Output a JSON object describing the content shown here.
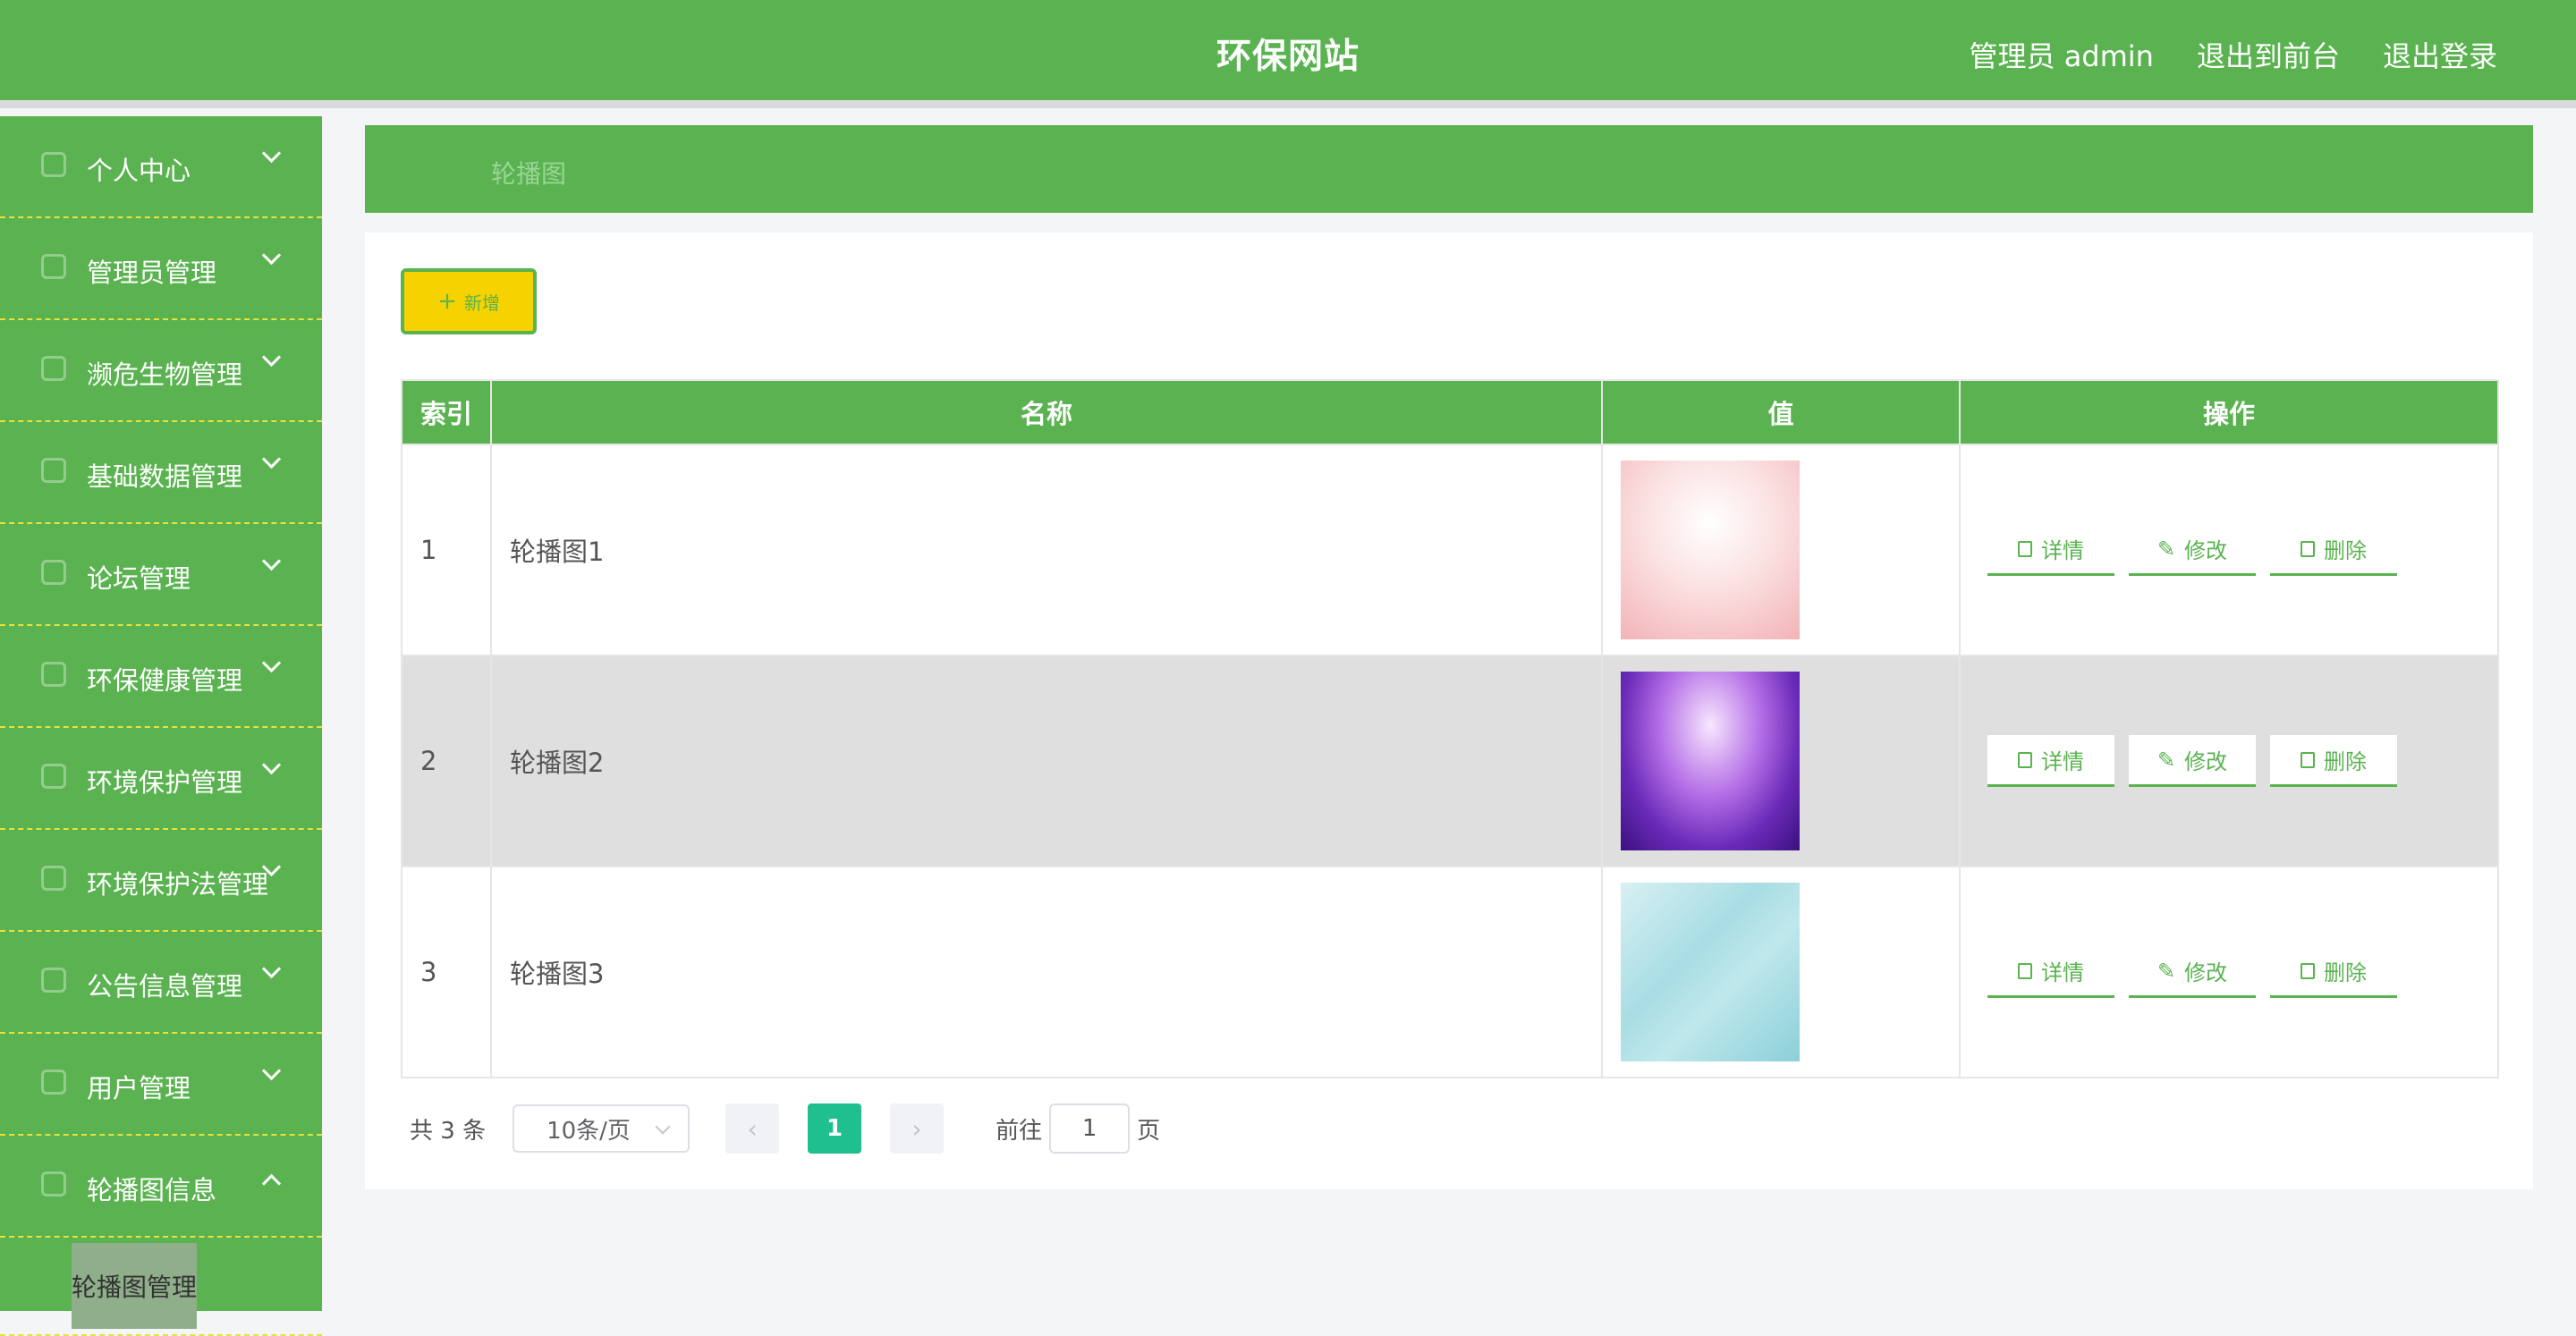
{
  "header": {
    "title": "环保网站",
    "admin_label": "管理员 admin",
    "to_front_label": "退出到前台",
    "logout_label": "退出登录"
  },
  "sidebar": {
    "items": [
      {
        "label": "个人中心"
      },
      {
        "label": "管理员管理"
      },
      {
        "label": "濒危生物管理"
      },
      {
        "label": "基础数据管理"
      },
      {
        "label": "论坛管理"
      },
      {
        "label": "环保健康管理"
      },
      {
        "label": "环境保护管理"
      },
      {
        "label": "环境保护法管理"
      },
      {
        "label": "公告信息管理"
      },
      {
        "label": "用户管理"
      },
      {
        "label": "轮播图信息",
        "expanded": true
      }
    ],
    "sub_item": "轮播图管理"
  },
  "breadcrumb": "轮播图",
  "toolbar": {
    "add_label": "新增"
  },
  "table": {
    "columns": [
      "索引",
      "名称",
      "值",
      "操作"
    ],
    "rows": [
      {
        "index": "1",
        "name": "轮播图1"
      },
      {
        "index": "2",
        "name": "轮播图2"
      },
      {
        "index": "3",
        "name": "轮播图3"
      }
    ],
    "actions": {
      "detail": "详情",
      "edit": "修改",
      "delete": "删除"
    }
  },
  "pagination": {
    "total_text": "共 3 条",
    "page_size": "10条/页",
    "current_page": "1",
    "goto_label": "前往",
    "goto_value": "1",
    "goto_unit": "页"
  },
  "colors": {
    "primary_green": "#5ab350",
    "add_button": "#f6d300",
    "active_page": "#1fbf8f",
    "sidebar_divider": "#e8e23a"
  }
}
